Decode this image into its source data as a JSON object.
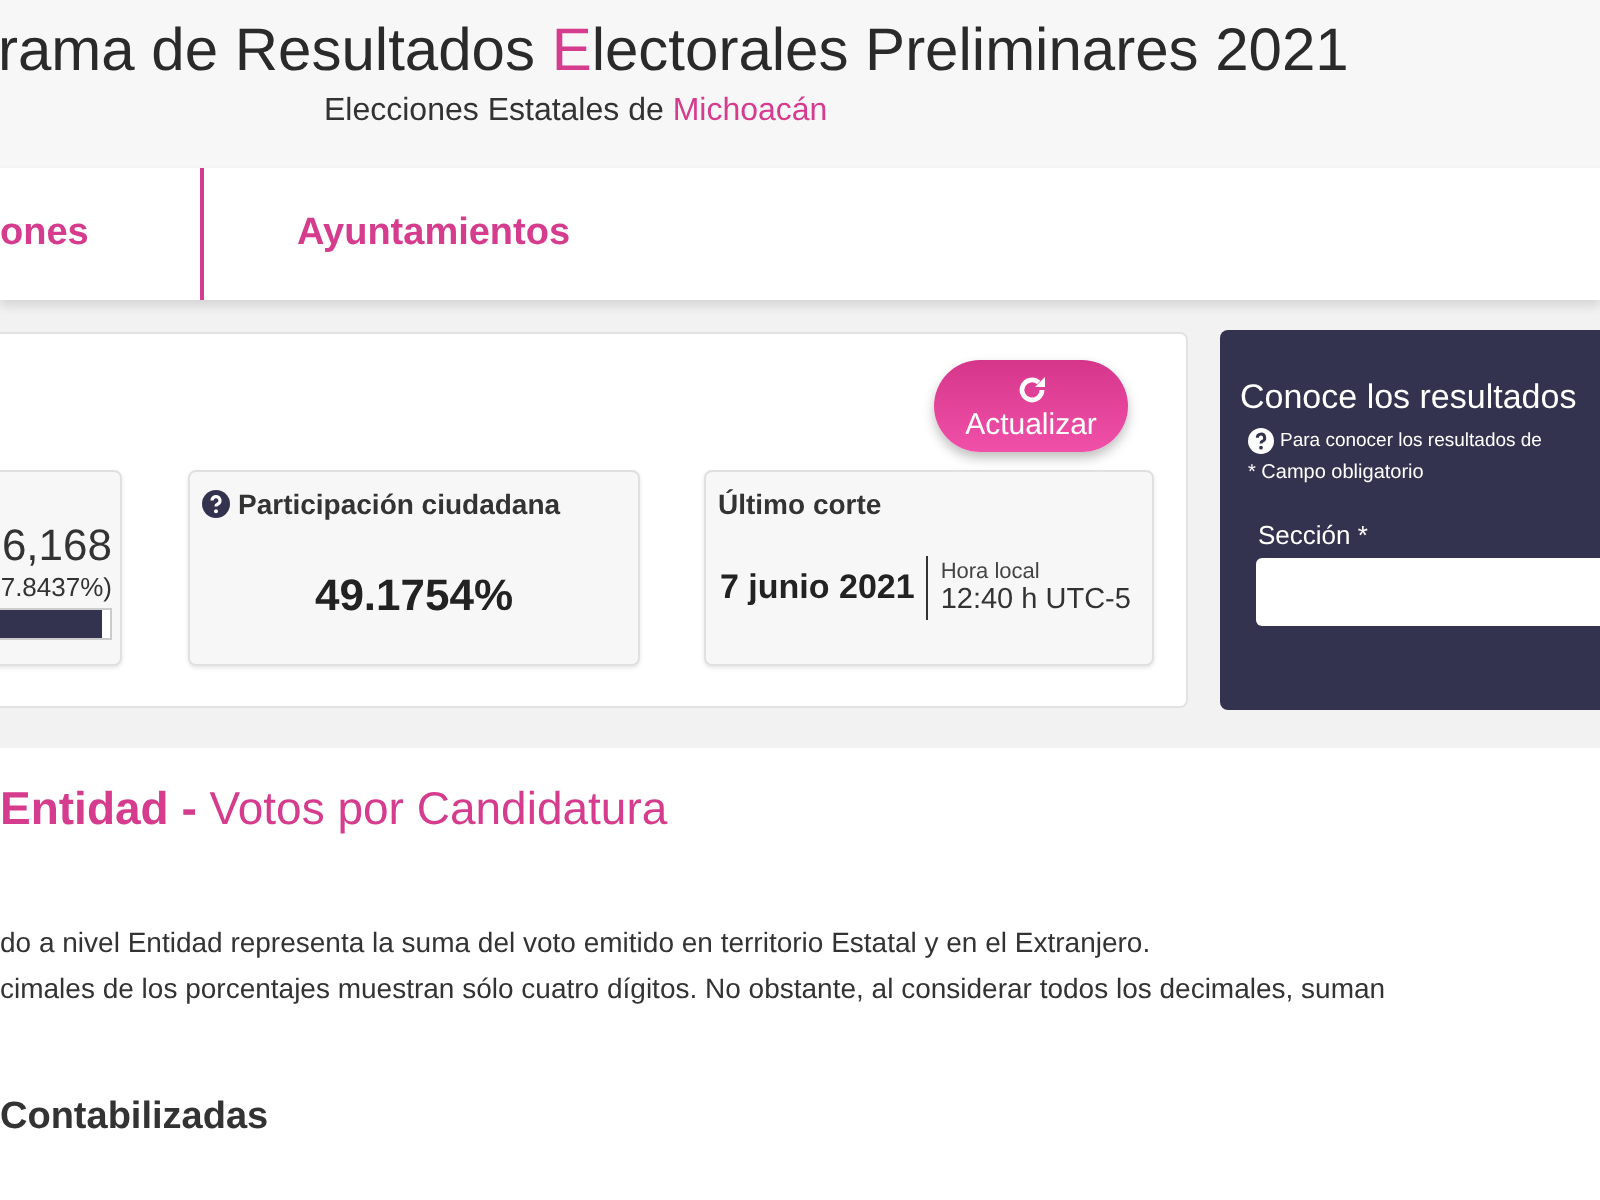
{
  "header": {
    "title_parts": [
      {
        "text": "rama de Resultados ",
        "highlight": false
      },
      {
        "text": "E",
        "highlight": true
      },
      {
        "text": "lectorales Preliminares 2021",
        "highlight": false
      }
    ],
    "subtitle_parts": [
      {
        "text": "Elecciones Estatales de ",
        "highlight": false
      },
      {
        "text": "Michoacán",
        "highlight": true
      }
    ]
  },
  "nav": {
    "tabs": [
      {
        "label": "ones",
        "selected": false
      },
      {
        "label": "Ayuntamientos",
        "selected": false
      }
    ]
  },
  "summary": {
    "refresh_button": "Actualizar",
    "actas_card": {
      "value": "6,168",
      "percent": "7.8437%)",
      "level": 0.95
    },
    "participation_card": {
      "title": "Participación ciudadana",
      "value": "49.1754%"
    },
    "cut_card": {
      "title": "Último corte",
      "date": "7 junio 2021",
      "time_label": "Hora local",
      "time": "12:40 h UTC-5"
    }
  },
  "search_panel": {
    "title": "Conoce los resultados",
    "hint": "Para conocer los resultados de",
    "required_note": "* Campo obligatorio",
    "field_label": "Sección *"
  },
  "section": {
    "title_bold": "Entidad -",
    "title_rest": "Votos por Candidatura",
    "notes": [
      "do a nivel Entidad representa la suma del voto emitido en territorio Estatal y en el Extranjero.",
      "cimales de los porcentajes muestran sólo cuatro dígitos. No obstante, al considerar todos los decimales, suman"
    ],
    "subheading": "Contabilizadas"
  }
}
